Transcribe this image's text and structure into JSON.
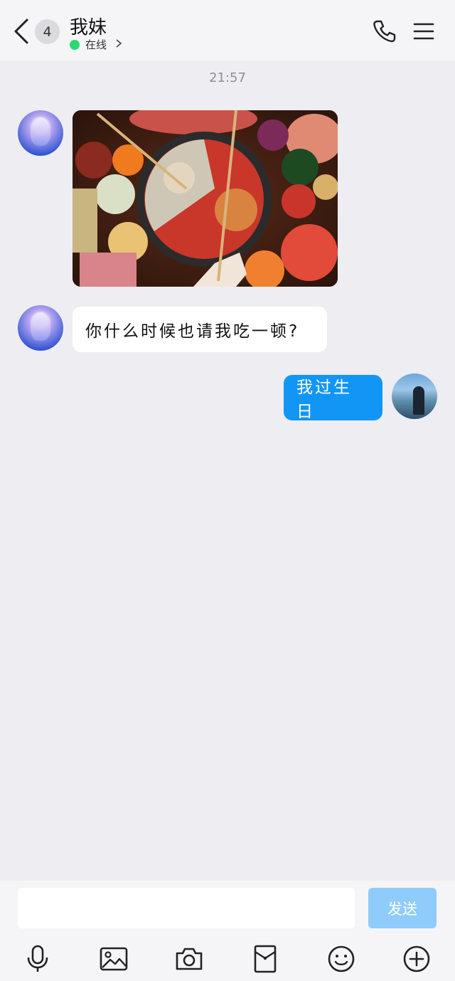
{
  "header": {
    "unread_count": "4",
    "contact_name": "我妹",
    "status_text": "在线",
    "status_color": "#2BD972"
  },
  "chat": {
    "timestamp": "21:57",
    "messages": [
      {
        "from": "friend",
        "type": "image",
        "description_icon": "photo"
      },
      {
        "from": "friend",
        "type": "text",
        "text": "你什么时候也请我吃一顿?"
      },
      {
        "from": "me",
        "type": "text",
        "text": "我过生日"
      }
    ]
  },
  "composer": {
    "input_value": "",
    "send_label": "发送"
  },
  "toolbar": {
    "icons": [
      "microphone-icon",
      "image-icon",
      "camera-icon",
      "red-packet-icon",
      "emoji-icon",
      "plus-icon"
    ]
  },
  "colors": {
    "accent": "#1296F5",
    "send_disabled": "#8FCCFB",
    "background": "#EDEDF2"
  }
}
